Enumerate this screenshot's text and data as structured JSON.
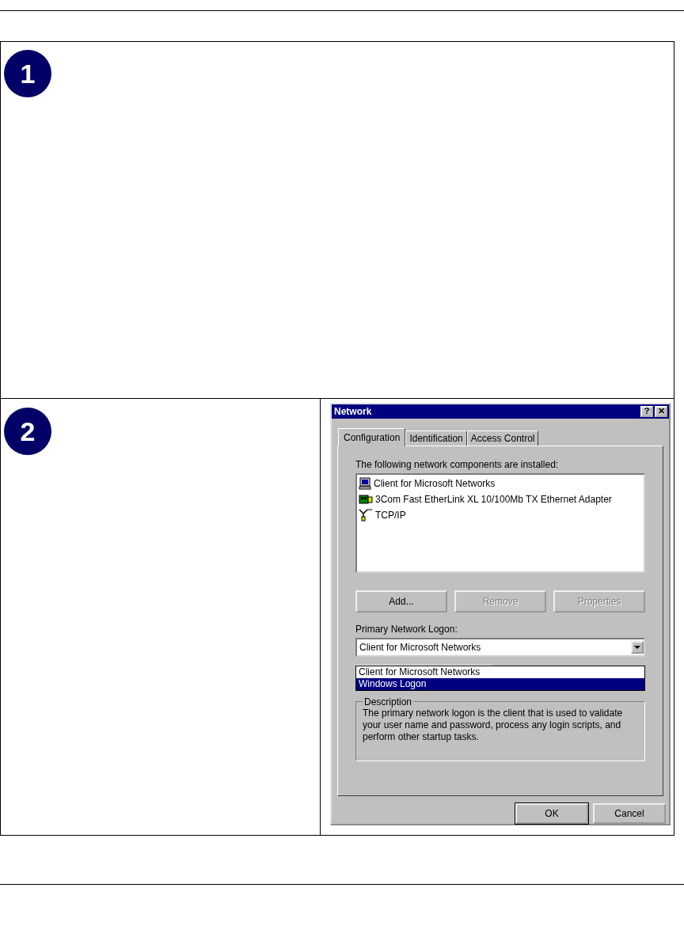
{
  "steps": [
    {
      "number": "1"
    },
    {
      "number": "2"
    }
  ],
  "dialog": {
    "title": "Network",
    "help_button": "?",
    "close_button": "✕",
    "tabs": [
      {
        "label": "Configuration",
        "selected": true
      },
      {
        "label": "Identification",
        "selected": false
      },
      {
        "label": "Access Control",
        "selected": false
      }
    ],
    "list_label": "The following network components are installed:",
    "components": [
      {
        "label": "Client for Microsoft Networks",
        "kind": "client"
      },
      {
        "label": "3Com Fast EtherLink XL 10/100Mb TX Ethernet Adapter",
        "kind": "adapter"
      },
      {
        "label": "TCP/IP",
        "kind": "protocol"
      }
    ],
    "buttons": [
      {
        "label": "Add...",
        "disabled": false
      },
      {
        "label": "Remove",
        "disabled": true
      },
      {
        "label": "Properties",
        "disabled": true
      }
    ],
    "logon_label": "Primary Network Logon:",
    "logon_value": "Client for Microsoft Networks",
    "logon_options": [
      {
        "label": "Client for Microsoft Networks",
        "selected": false
      },
      {
        "label": "Windows Logon",
        "selected": true
      }
    ],
    "description": {
      "title": "Description",
      "text": "The primary network logon is the client that is used to validate your user name and password, process any login scripts, and perform other startup tasks."
    },
    "footer_buttons": [
      {
        "label": "OK",
        "default": true
      },
      {
        "label": "Cancel",
        "default": false
      }
    ]
  }
}
